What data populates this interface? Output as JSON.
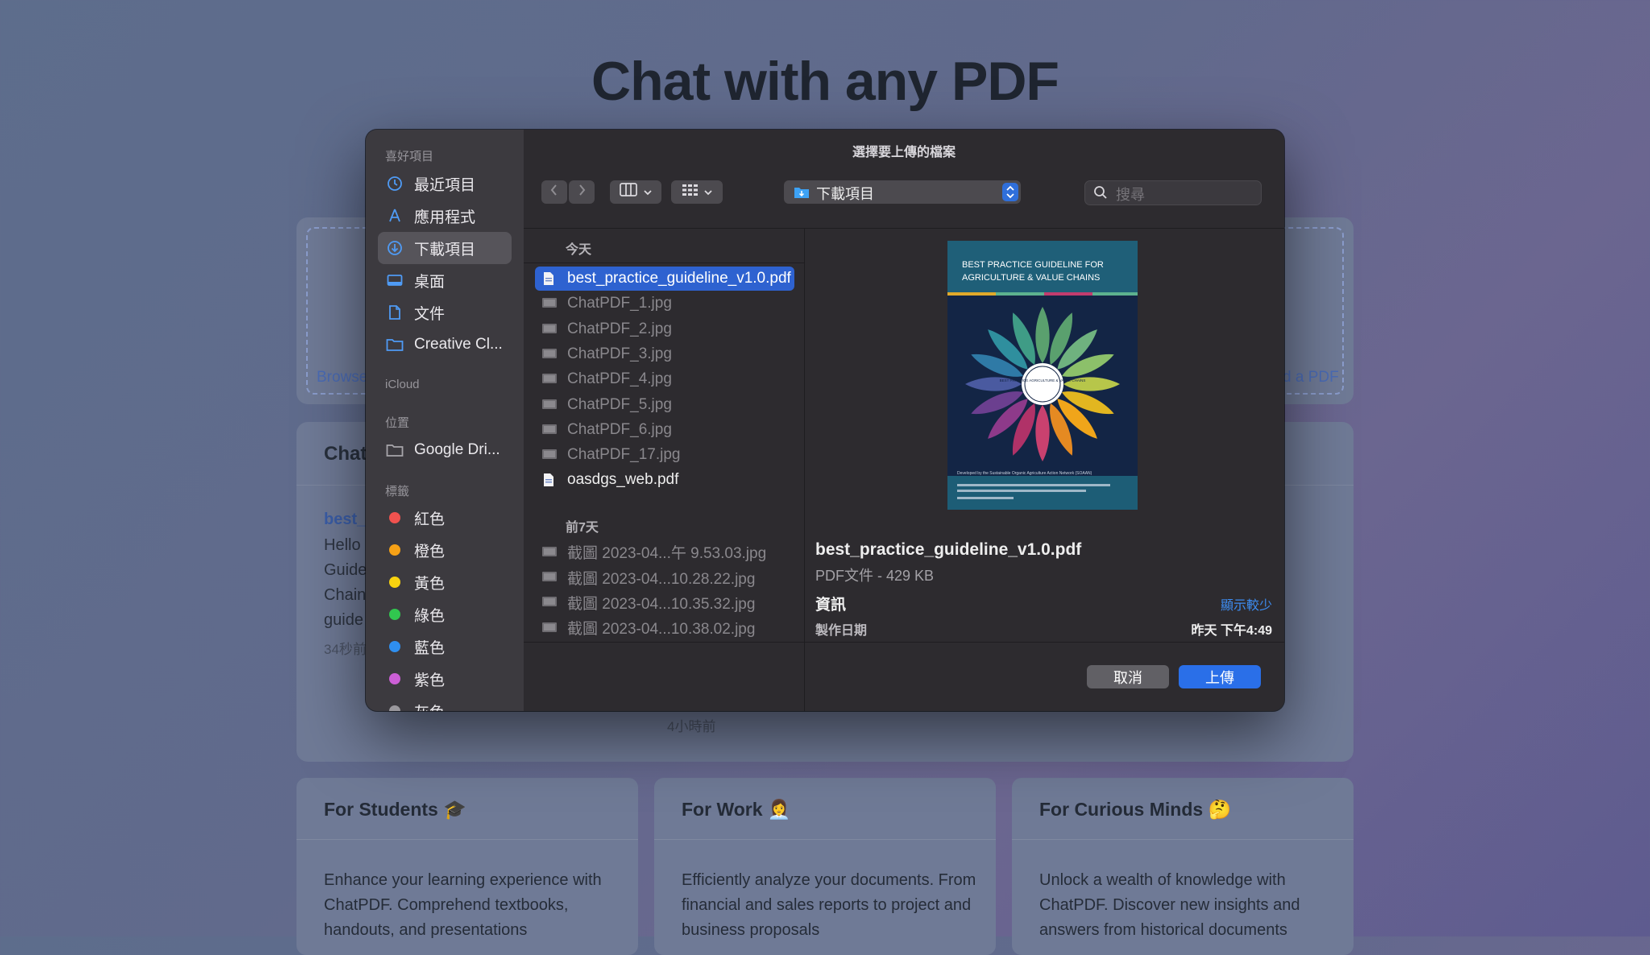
{
  "background": {
    "title": "Chat with any PDF",
    "upload_left": "Browse",
    "upload_right": "d a PDF",
    "chat_section_title": "Chat",
    "chat_item": {
      "name": "best_",
      "lines": [
        "Hello",
        "Guide",
        "Chain",
        "guide"
      ],
      "time": "34秒前"
    },
    "second_time": "4小時前",
    "cards": [
      {
        "title": "For Students 🎓",
        "text": "Enhance your learning experience with ChatPDF. Comprehend textbooks, handouts, and presentations"
      },
      {
        "title": "For Work 👩‍💼",
        "text": "Efficiently analyze your documents. From financial and sales reports to project and business proposals"
      },
      {
        "title": "For Curious Minds 🤔",
        "text": "Unlock a wealth of knowledge with ChatPDF. Discover new insights and answers from historical documents"
      }
    ]
  },
  "dialog": {
    "title": "選擇要上傳的檔案",
    "sidebar": {
      "favorites_label": "喜好項目",
      "favorites": [
        {
          "label": "最近項目",
          "icon": "clock-icon"
        },
        {
          "label": "應用程式",
          "icon": "applications-icon"
        },
        {
          "label": "下載項目",
          "icon": "download-icon",
          "selected": true
        },
        {
          "label": "桌面",
          "icon": "desktop-icon"
        },
        {
          "label": "文件",
          "icon": "document-icon"
        },
        {
          "label": "Creative Cl...",
          "icon": "folder-icon"
        }
      ],
      "icloud_label": "iCloud",
      "locations_label": "位置",
      "locations": [
        {
          "label": "Google Dri...",
          "icon": "folder-icon"
        }
      ],
      "tags_label": "標籤",
      "tags": [
        {
          "label": "紅色",
          "color": "#f0524f"
        },
        {
          "label": "橙色",
          "color": "#f6a116"
        },
        {
          "label": "黃色",
          "color": "#f8d30f"
        },
        {
          "label": "綠色",
          "color": "#31c74f"
        },
        {
          "label": "藍色",
          "color": "#2f8ff0"
        },
        {
          "label": "紫色",
          "color": "#cc5fd6"
        },
        {
          "label": "灰色",
          "color": "#9a989d"
        }
      ]
    },
    "toolbar": {
      "location": "下載項目",
      "search_placeholder": "搜尋"
    },
    "file_list": {
      "groups": [
        {
          "label": "今天",
          "files": [
            {
              "name": "best_practice_guideline_v1.0.pdf",
              "kind": "pdf",
              "selected": true
            },
            {
              "name": "ChatPDF_1.jpg",
              "kind": "image"
            },
            {
              "name": "ChatPDF_2.jpg",
              "kind": "image"
            },
            {
              "name": "ChatPDF_3.jpg",
              "kind": "image"
            },
            {
              "name": "ChatPDF_4.jpg",
              "kind": "image"
            },
            {
              "name": "ChatPDF_5.jpg",
              "kind": "image"
            },
            {
              "name": "ChatPDF_6.jpg",
              "kind": "image"
            },
            {
              "name": "ChatPDF_17.jpg",
              "kind": "image"
            },
            {
              "name": "oasdgs_web.pdf",
              "kind": "pdf"
            }
          ]
        },
        {
          "label": "前7天",
          "files": [
            {
              "name": "截圖 2023-04...午 9.53.03.jpg",
              "kind": "image"
            },
            {
              "name": "截圖 2023-04...10.28.22.jpg",
              "kind": "image"
            },
            {
              "name": "截圖 2023-04...10.35.32.jpg",
              "kind": "image"
            },
            {
              "name": "截圖 2023-04...10.38.02.jpg",
              "kind": "image"
            }
          ]
        }
      ]
    },
    "preview": {
      "cover_title_line1": "BEST PRACTICE GUIDELINE FOR",
      "cover_title_line2": "AGRICULTURE & VALUE CHAINS",
      "cover_center": "BEST PRACTICE AGRICULTURE & VALUE CHAINS",
      "cover_footer": "Developed by the Sustainable Organic Agriculture Action Network (SOAAN)",
      "file_name": "best_practice_guideline_v1.0.pdf",
      "file_meta": "PDF文件 - 429 KB",
      "info_label": "資訊",
      "show_less": "顯示較少",
      "created_label": "製作日期",
      "created_value": "昨天 下午4:49"
    },
    "buttons": {
      "cancel": "取消",
      "upload": "上傳"
    }
  }
}
